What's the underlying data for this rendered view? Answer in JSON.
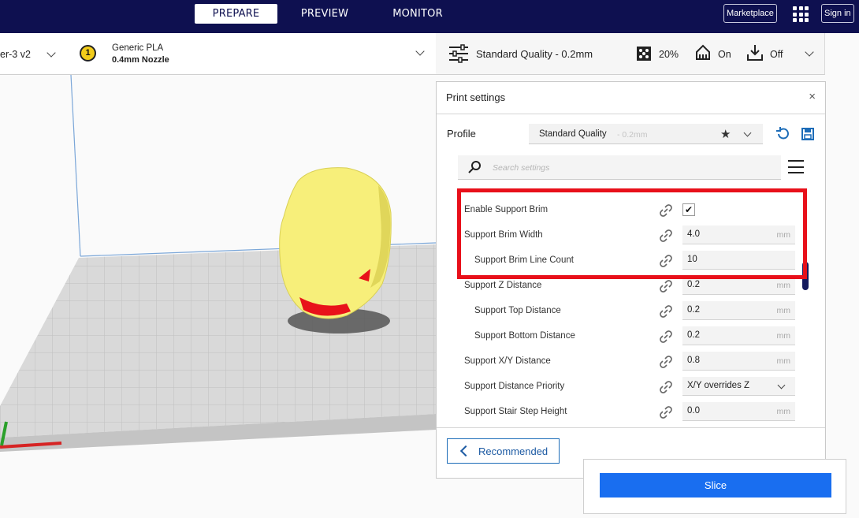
{
  "topbar": {
    "stages": [
      "PREPARE",
      "PREVIEW",
      "MONITOR"
    ],
    "marketplace": "Marketplace",
    "sign_in": "Sign in"
  },
  "header": {
    "printer": "er-3 v2",
    "material": {
      "name": "Generic PLA",
      "nozzle": "0.4mm Nozzle",
      "extruder_number": "1"
    },
    "quality": {
      "profile": "Standard Quality - 0.2mm",
      "infill": "20%",
      "support": "On",
      "adhesion": "Off"
    }
  },
  "panel": {
    "title": "Print settings",
    "close": "×",
    "profile_label": "Profile",
    "profile_name": "Standard Quality",
    "profile_sub": "- 0.2mm",
    "search_placeholder": "Search settings",
    "settings": [
      {
        "label": "Enable Support Brim",
        "type": "checkbox",
        "checked": "✔"
      },
      {
        "label": "Support Brim Width",
        "value": "4.0",
        "unit": "mm"
      },
      {
        "label": "Support Brim Line Count",
        "value": "10",
        "unit": ""
      },
      {
        "label": "Support Z Distance",
        "value": "0.2",
        "unit": "mm"
      },
      {
        "label": "Support Top Distance",
        "value": "0.2",
        "unit": "mm"
      },
      {
        "label": "Support Bottom Distance",
        "value": "0.2",
        "unit": "mm"
      },
      {
        "label": "Support X/Y Distance",
        "value": "0.8",
        "unit": "mm"
      },
      {
        "label": "Support Distance Priority",
        "value": "X/Y overrides Z",
        "type": "dropdown"
      },
      {
        "label": "Support Stair Step Height",
        "value": "0.0",
        "unit": "mm"
      }
    ],
    "recommended_label": "Recommended"
  },
  "slice": {
    "label": "Slice"
  },
  "colors": {
    "topbar": "#0e1050",
    "accent": "#196ef0",
    "highlight": "#e8101a",
    "model": "#f7ef7a"
  }
}
